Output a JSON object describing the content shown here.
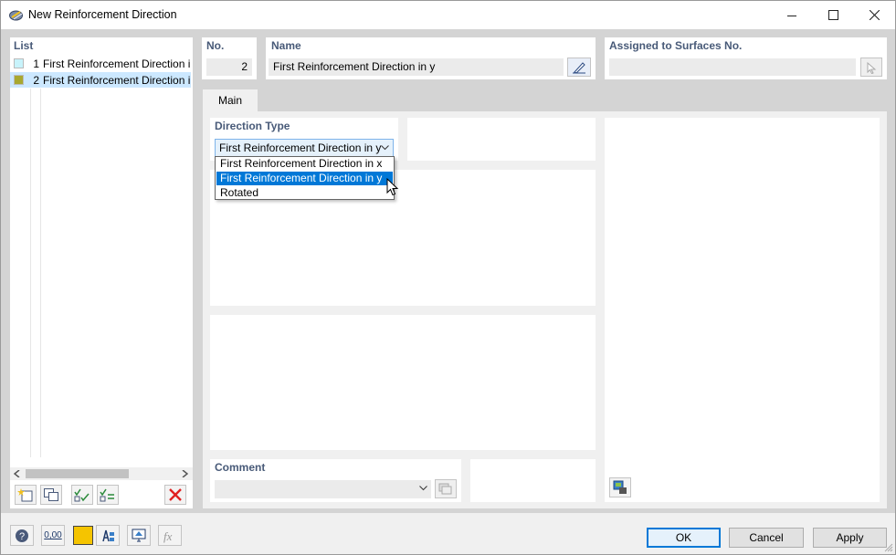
{
  "window": {
    "title": "New Reinforcement Direction"
  },
  "list": {
    "header": "List",
    "items": [
      {
        "no": "1",
        "label": "First Reinforcement Direction in x",
        "color": "#c8f3fb"
      },
      {
        "no": "2",
        "label": "First Reinforcement Direction in y",
        "color": "#a8a830"
      }
    ]
  },
  "no_field": {
    "header": "No.",
    "value": "2"
  },
  "name_field": {
    "header": "Name",
    "value": "First Reinforcement Direction in y"
  },
  "assigned": {
    "header": "Assigned to Surfaces No.",
    "value": ""
  },
  "tabs": [
    {
      "label": "Main"
    }
  ],
  "direction_type": {
    "header": "Direction Type",
    "selected": "First Reinforcement Direction in y",
    "options": [
      "First Reinforcement Direction in x",
      "First Reinforcement Direction in y",
      "Rotated"
    ]
  },
  "comment": {
    "header": "Comment",
    "value": ""
  },
  "buttons": {
    "ok": "OK",
    "cancel": "Cancel",
    "apply": "Apply"
  },
  "bottom_tools": {
    "units_value": "0,00"
  },
  "colors": {
    "selection_blue": "#0078d7",
    "header_text": "#485a78",
    "delete_red": "#e02020"
  }
}
